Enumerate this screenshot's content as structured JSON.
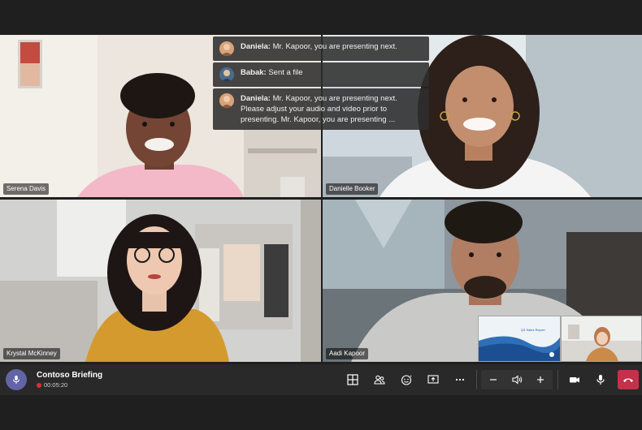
{
  "participants": [
    {
      "name": "Serena Davis"
    },
    {
      "name": "Danielle Booker"
    },
    {
      "name": "Krystal McKinney"
    },
    {
      "name": "Aadi Kapoor"
    }
  ],
  "chat": [
    {
      "sender": "Daniela:",
      "text": "Mr. Kapoor, you are presenting next."
    },
    {
      "sender": "Babak:",
      "text": "Sent a file"
    },
    {
      "sender": "Daniela:",
      "text": "Mr. Kapoor, you are presenting next. Please adjust your audio and video prior to presenting. Mr. Kapoor, you are presenting ..."
    }
  ],
  "meeting": {
    "title": "Contoso Briefing",
    "elapsed": "00:05:20"
  },
  "shared_slide": {
    "title": "Q3 Sales Report"
  },
  "icons": {
    "mic": "microphone-icon",
    "layout": "grid-layout-icon",
    "people": "participants-icon",
    "reactions": "reaction-icon",
    "share": "share-screen-icon",
    "more": "more-options-icon",
    "volume_down": "minus-icon",
    "volume": "speaker-icon",
    "volume_up": "plus-icon",
    "camera": "camera-icon",
    "mute": "microphone-toggle-icon",
    "hangup": "hang-up-icon"
  },
  "colors": {
    "accent": "#6264a7",
    "hangup": "#c4314b",
    "recording": "#d13438",
    "toolbar": "#292929"
  }
}
